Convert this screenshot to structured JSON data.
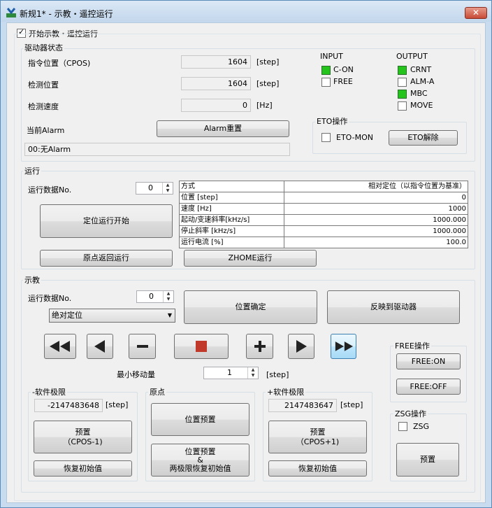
{
  "window": {
    "title": "新规1* - 示教・遥控运行",
    "close": "✕"
  },
  "enable": {
    "label": "开始示教・遥控运行"
  },
  "driver": {
    "title": "驱动器状态",
    "cmd_pos_label": "指令位置（CPOS)",
    "cmd_pos": "1604",
    "cmd_pos_unit": "[step]",
    "det_pos_label": "检测位置",
    "det_pos": "1604",
    "det_pos_unit": "[step]",
    "det_spd_label": "检测速度",
    "det_spd": "0",
    "det_spd_unit": "[Hz]",
    "alarm_label": "当前Alarm",
    "alarm_reset": "Alarm重置",
    "alarm_value": "00:无Alarm",
    "input_title": "INPUT",
    "inputs": [
      {
        "label": "C-ON",
        "on": true
      },
      {
        "label": "FREE",
        "on": false
      }
    ],
    "output_title": "OUTPUT",
    "outputs": [
      {
        "label": "CRNT",
        "on": true
      },
      {
        "label": "ALM-A",
        "on": false
      },
      {
        "label": "MBC",
        "on": true
      },
      {
        "label": "MOVE",
        "on": false
      }
    ],
    "eto_title": "ETO操作",
    "eto_mon": "ETO-MON",
    "eto_release": "ETO解除"
  },
  "run": {
    "title": "运行",
    "data_no_label": "运行数据No.",
    "data_no": "0",
    "start": "定位运行开始",
    "home": "原点返回运行",
    "zhome": "ZHOME运行",
    "table": [
      [
        "方式",
        "相对定位（以指令位置为基准）"
      ],
      [
        "位置 [step]",
        "0"
      ],
      [
        "速度 [Hz]",
        "1000"
      ],
      [
        "起动/变速斜率[kHz/s]",
        "1000.000"
      ],
      [
        "停止斜率 [kHz/s]",
        "1000.000"
      ],
      [
        "运行电流 [%]",
        "100.0"
      ]
    ]
  },
  "teach": {
    "title": "示教",
    "data_no_label": "运行数据No.",
    "data_no": "0",
    "mode": "绝对定位",
    "confirm": "位置确定",
    "reflect": "反映到驱动器",
    "min_move_label": "最小移动量",
    "min_move": "1",
    "min_move_unit": "[step]",
    "neg_title": "-软件极限",
    "neg_value": "-2147483648",
    "neg_unit": "[step]",
    "neg_preset_1": "预置",
    "neg_preset_2": "（CPOS-1)",
    "neg_restore": "恢复初始值",
    "origin_title": "原点",
    "origin_preset": "位置预置",
    "origin_both_1": "位置预置",
    "origin_both_2": "&",
    "origin_both_3": "两极限恢复初始值",
    "pos_title": "+软件极限",
    "pos_value": "2147483647",
    "pos_unit": "[step]",
    "pos_preset_1": "预置",
    "pos_preset_2": "（CPOS+1)",
    "pos_restore": "恢复初始值",
    "free_title": "FREE操作",
    "free_on": "FREE:ON",
    "free_off": "FREE:OFF",
    "zsg_title": "ZSG操作",
    "zsg_label": "ZSG",
    "zsg_preset": "预置"
  },
  "colors": {
    "led_on": "#25c41d",
    "stop": "#c0392b",
    "frame": "#c9dcef"
  }
}
